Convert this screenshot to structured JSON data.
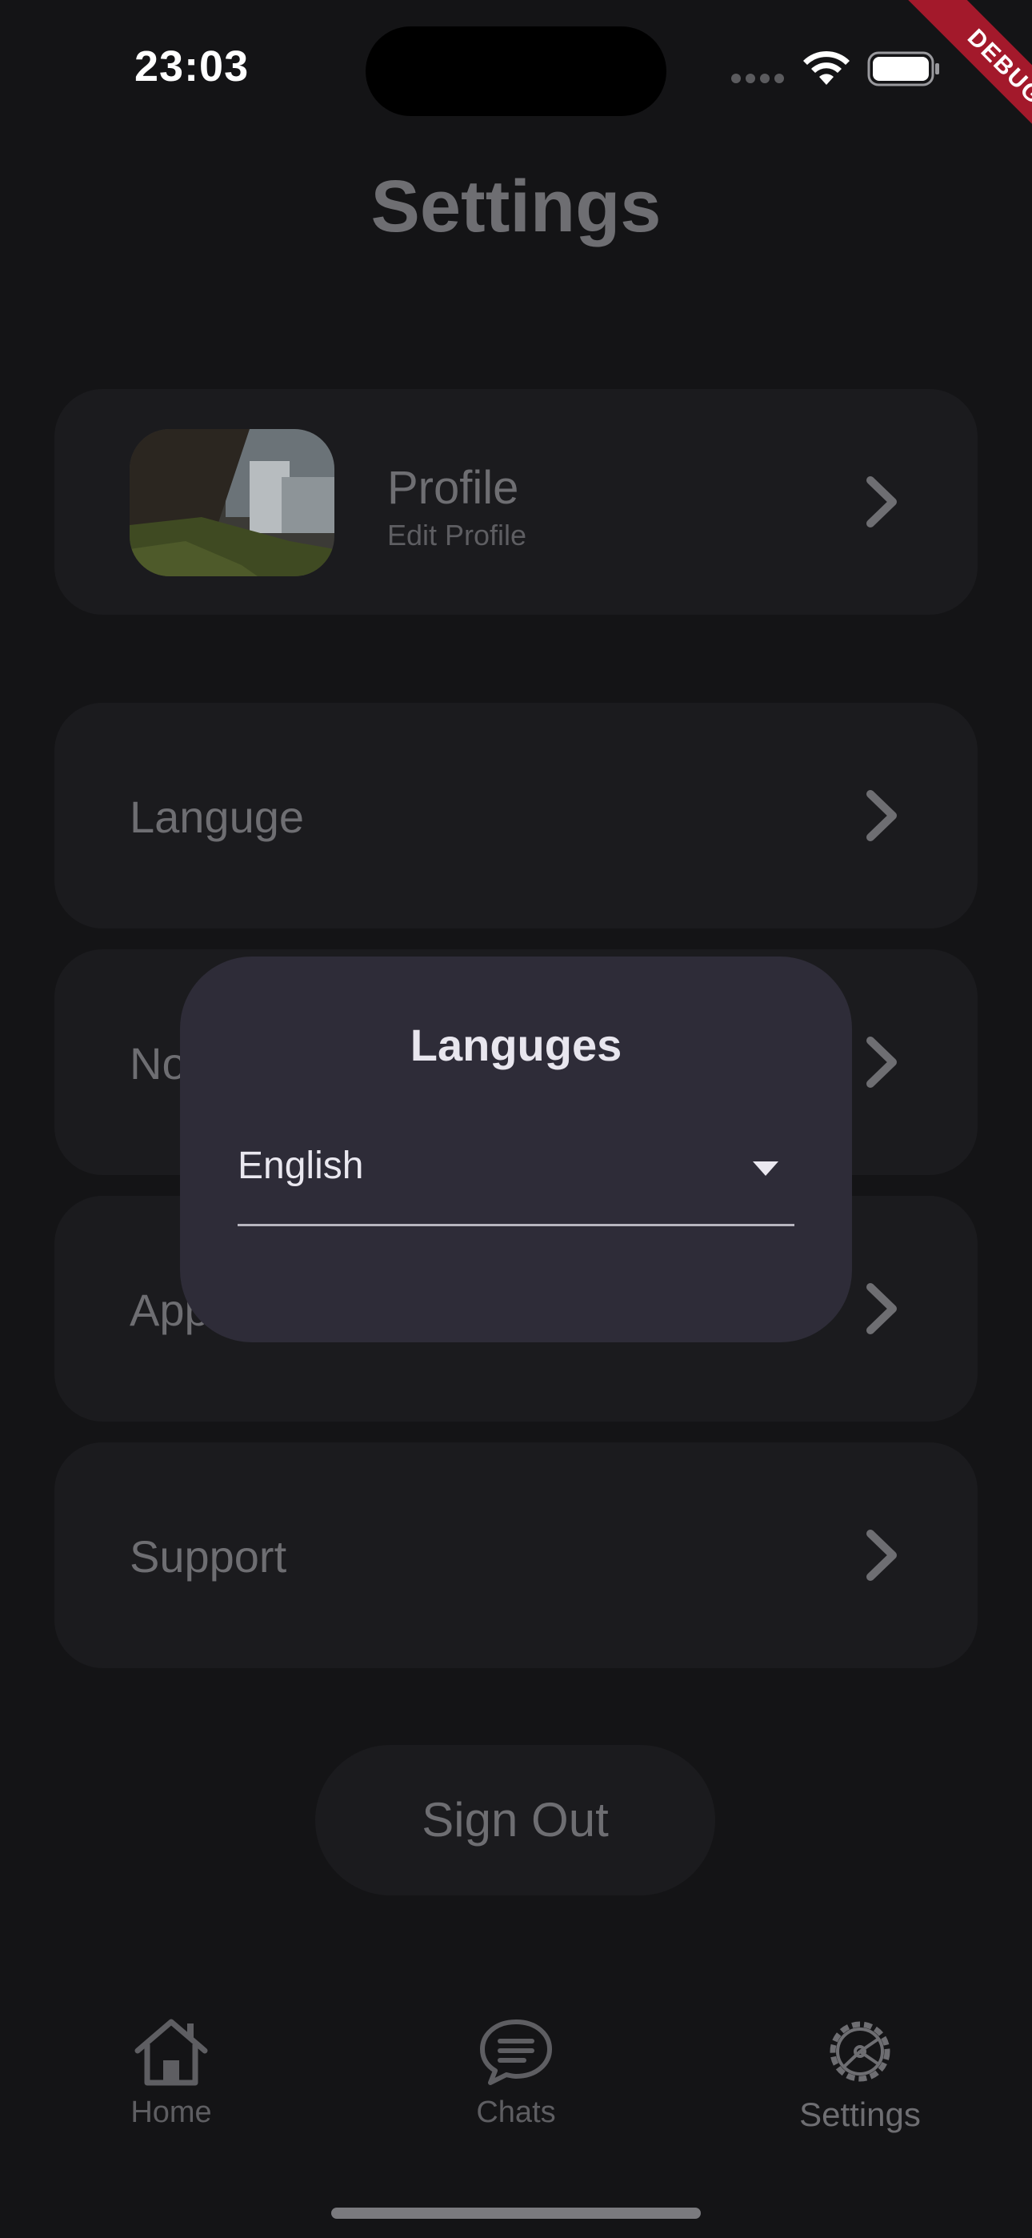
{
  "status_bar": {
    "time": "23:03"
  },
  "debug_banner": "DEBUG",
  "header": {
    "title": "Settings"
  },
  "profile": {
    "title": "Profile",
    "subtitle": "Edit Profile"
  },
  "settings_items": [
    {
      "label": "Languge"
    },
    {
      "label": "Notifications"
    },
    {
      "label": "Appearance"
    },
    {
      "label": "Support"
    }
  ],
  "sign_out_label": "Sign Out",
  "tabs": [
    {
      "label": "Home",
      "icon": "home-icon"
    },
    {
      "label": "Chats",
      "icon": "chat-bubble-icon"
    },
    {
      "label": "Settings",
      "icon": "settings-gear-icon",
      "active": true
    }
  ],
  "dialog": {
    "title": "Languges",
    "selected_language": "English"
  },
  "colors": {
    "background": "#141416",
    "card": "#1b1b1e",
    "dialog": "#2e2c38",
    "debug_ribbon": "#a3192b"
  }
}
